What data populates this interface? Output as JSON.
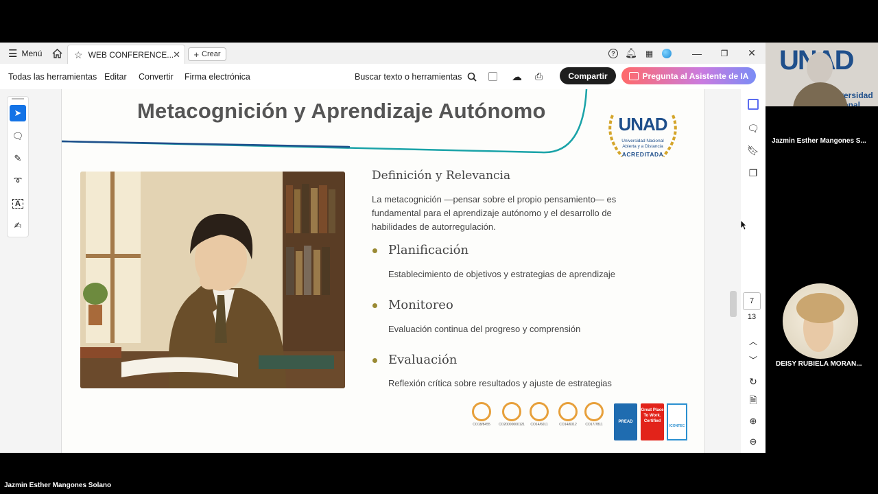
{
  "window": {
    "menu_label": "Menú",
    "tab_title": "WEB CONFERENCE...",
    "create_label": "Crear"
  },
  "toolbar": {
    "all_tools": "Todas las herramientas",
    "edit": "Editar",
    "convert": "Convertir",
    "esign": "Firma electrónica",
    "search_placeholder": "Buscar texto o herramientas",
    "share_label": "Compartir",
    "ai_label": "Pregunta al Asistente de IA"
  },
  "slide": {
    "title": "Metacognición y Aprendizaje Autónomo",
    "logo": {
      "name": "UNAD",
      "subtitle_1": "Universidad Nacional",
      "subtitle_2": "Abierta y a Distancia",
      "badge": "ACREDITADA"
    },
    "section_title": "Definición y Relevancia",
    "intro_lines": [
      "La metacognición —pensar sobre el propio pensamiento— es",
      "fundamental para el aprendizaje autónomo y el desarrollo de",
      "habilidades de autorregulación."
    ],
    "items": [
      {
        "heading": "Planificación",
        "text": "Establecimiento de objetivos y estrategias de aprendizaje"
      },
      {
        "heading": "Monitoreo",
        "text": "Evaluación continua del progreso y comprensión"
      },
      {
        "heading": "Evaluación",
        "text": "Reflexión crítica sobre resultados y ajuste de estrategias"
      }
    ],
    "certifications": [
      "CO18/8455",
      "CO20000000121",
      "CO14/6011",
      "CO14/6012",
      "CO17/7811"
    ],
    "badges": [
      "PREAD",
      "Great Place To Work. Certified",
      "ICONTEC"
    ]
  },
  "pagination": {
    "current": "7",
    "total": "13"
  },
  "participants": [
    {
      "name": "Jazmin Esther Mangones S...",
      "banner_text": "UNAD",
      "banner_sub": "Universidad Nacional"
    },
    {
      "name": "DEISY RUBIELA MORAN..."
    }
  ],
  "active_speaker": "Jazmin Esther Mangones Solano",
  "colors": {
    "accent_teal": "#1aa3a8",
    "unad_blue": "#1f4f8b",
    "unad_gold": "#e8a526",
    "share_button": "#1e1e1e"
  }
}
